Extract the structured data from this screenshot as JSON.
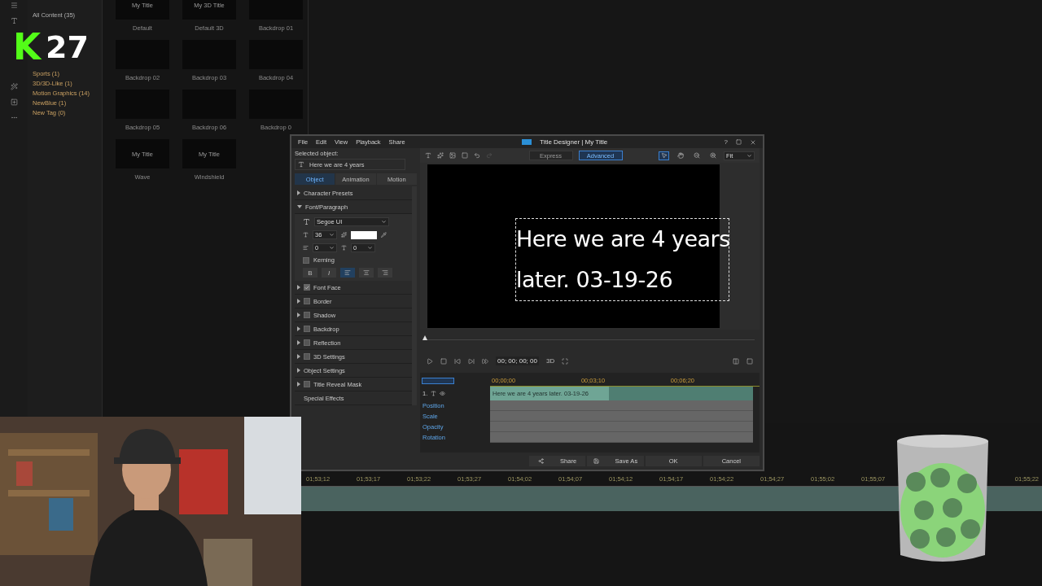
{
  "overlay_badge": {
    "letter": "K",
    "count": "27"
  },
  "library": {
    "all_content": "All Content (35)",
    "categories": [
      "Sports (1)",
      "3D/3D-Like (1)",
      "Motion Graphics (14)",
      "NewBlue (1)",
      "New Tag (0)"
    ],
    "thumbnails": [
      {
        "preview_text": "My Title",
        "label": "Default"
      },
      {
        "preview_text": "My 3D Title",
        "label": "Default 3D"
      },
      {
        "label": "Backdrop 01"
      },
      {
        "label": "Backdrop 02"
      },
      {
        "label": "Backdrop 03"
      },
      {
        "label": "Backdrop 04"
      },
      {
        "label": "Backdrop 05"
      },
      {
        "label": "Backdrop 06"
      },
      {
        "label": "Backdrop 0"
      },
      {
        "preview_text": "My Title",
        "label": "Wave"
      },
      {
        "preview_text": "My Title",
        "label": "Windshield"
      }
    ]
  },
  "main_timeline": {
    "ruler": [
      "01;53;12",
      "01;53;17",
      "01;53;22",
      "01;53;27",
      "01;54;02",
      "01;54;07",
      "01;54;12",
      "01;54;17",
      "01;54;22",
      "01;54;27",
      "01;55;02",
      "01;55;07",
      "01;55;22"
    ]
  },
  "title_designer": {
    "title": "Title Designer | My Title",
    "menu": [
      "File",
      "Edit",
      "View",
      "Playback",
      "Share"
    ],
    "window_controls": [
      "?"
    ],
    "selected_object_label": "Selected object:",
    "selected_object": "Here we are 4 years",
    "tabs": [
      {
        "label": "Object",
        "selected": true
      },
      {
        "label": "Animation",
        "selected": false
      },
      {
        "label": "Motion",
        "selected": false
      }
    ],
    "sections": [
      {
        "kind": "group",
        "label": "Character Presets",
        "expanded": false
      },
      {
        "kind": "group",
        "label": "Font/Paragraph",
        "expanded": true
      },
      {
        "kind": "check",
        "label": "Font Face",
        "checked": true
      },
      {
        "kind": "check",
        "label": "Border",
        "checked": false
      },
      {
        "kind": "check",
        "label": "Shadow",
        "checked": false
      },
      {
        "kind": "check",
        "label": "Backdrop",
        "checked": false
      },
      {
        "kind": "check",
        "label": "Reflection",
        "checked": false
      },
      {
        "kind": "check",
        "label": "3D Settings",
        "checked": false
      },
      {
        "kind": "group",
        "label": "Object Settings",
        "expanded": false
      },
      {
        "kind": "check",
        "label": "Title Reveal Mask",
        "checked": false
      },
      {
        "kind": "plain",
        "label": "Special Effects"
      }
    ],
    "font": {
      "family": "Segoe UI",
      "size": "36",
      "line_spacing": "0",
      "char_spacing": "0",
      "kerning": {
        "label": "Kerning",
        "checked": false
      },
      "bold": "B",
      "italic": "I",
      "alignment": [
        {
          "selected": true
        },
        {
          "selected": false
        },
        {
          "selected": false
        }
      ]
    },
    "modes": [
      {
        "label": "Express",
        "selected": false
      },
      {
        "label": "Advanced",
        "selected": true
      }
    ],
    "view_tools": [
      {
        "kind": "pointer",
        "selected": true
      },
      {
        "kind": "hand",
        "selected": false
      },
      {
        "kind": "zoom-out",
        "selected": false
      },
      {
        "kind": "zoom-in",
        "selected": false
      }
    ],
    "zoom": "Fit",
    "canvas_lines": [
      "Here we are 4 years",
      "later. 03-19-26"
    ],
    "playhead": {
      "level": 0
    },
    "timecode": "00; 00; 00; 00",
    "mode_3d": "3D",
    "ruler": [
      "00;00;00",
      "00;03;10",
      "00;06;20"
    ],
    "track": {
      "number": "1.",
      "clip": "Here we are 4 years later. 03-19-26"
    },
    "keyframes": [
      "Position",
      "Scale",
      "Opacity",
      "Rotation"
    ],
    "buttons": [
      {
        "kind": "share",
        "label": "Share"
      },
      {
        "kind": "save",
        "label": "Save As"
      },
      {
        "kind": "plain",
        "label": "OK"
      },
      {
        "kind": "plain",
        "label": "Cancel"
      }
    ]
  }
}
